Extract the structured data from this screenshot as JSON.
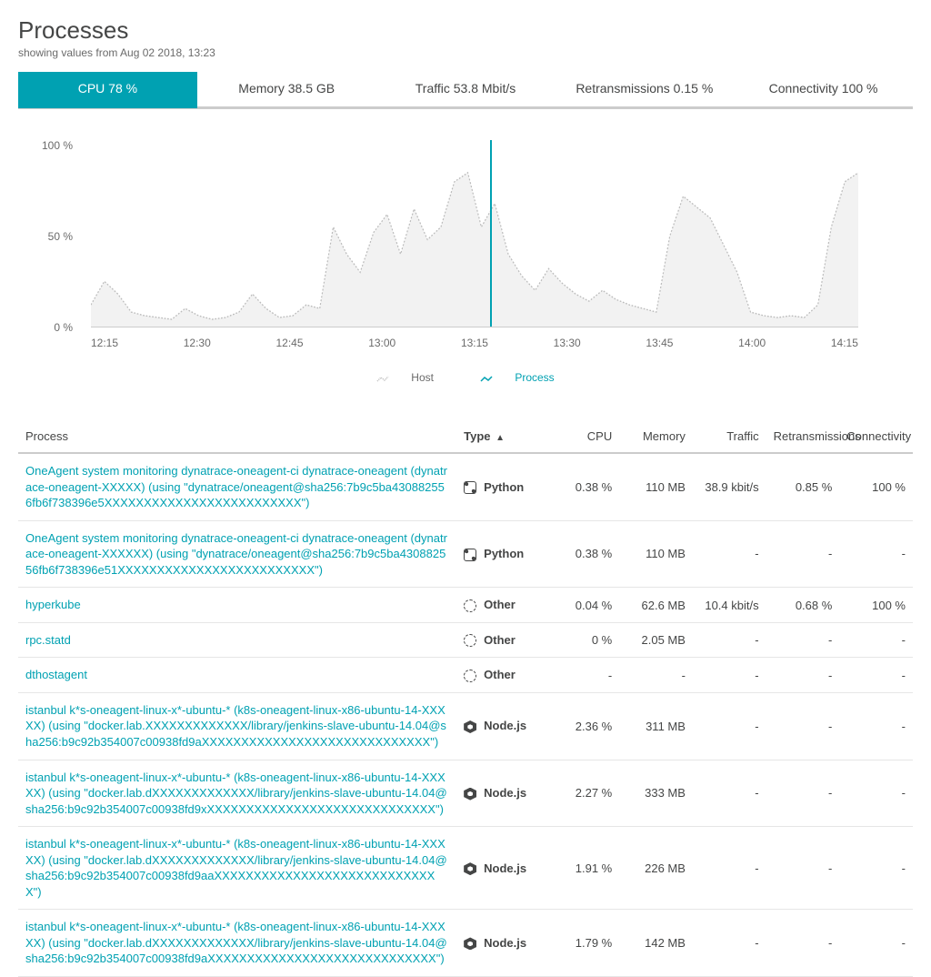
{
  "header": {
    "title": "Processes",
    "subtitle": "showing values from Aug 02 2018, 13:23"
  },
  "tabs": [
    {
      "label": "CPU 78 %",
      "active": true
    },
    {
      "label": "Memory 38.5 GB",
      "active": false
    },
    {
      "label": "Traffic 53.8 Mbit/s",
      "active": false
    },
    {
      "label": "Retransmissions 0.15 %",
      "active": false
    },
    {
      "label": "Connectivity 100 %",
      "active": false
    }
  ],
  "chart_data": {
    "type": "line",
    "title": "",
    "xlabel": "",
    "ylabel": "",
    "ylim": [
      0,
      100
    ],
    "y_ticks": [
      "0 %",
      "50 %",
      "100 %"
    ],
    "x_ticks": [
      "12:15",
      "12:30",
      "12:45",
      "13:00",
      "13:15",
      "13:30",
      "13:45",
      "14:00",
      "14:15"
    ],
    "marker_x": "13:23",
    "marker_pos_pct": 52,
    "series": [
      {
        "name": "Host",
        "color": "#bbbbbb",
        "style": "dotted",
        "values": [
          12,
          25,
          18,
          8,
          6,
          5,
          4,
          10,
          6,
          4,
          5,
          8,
          18,
          10,
          5,
          6,
          12,
          10,
          55,
          40,
          30,
          52,
          62,
          40,
          65,
          48,
          55,
          80,
          85,
          55,
          68,
          40,
          28,
          20,
          32,
          24,
          18,
          14,
          20,
          15,
          12,
          10,
          8,
          50,
          72,
          66,
          60,
          45,
          30,
          8,
          6,
          5,
          6,
          5,
          12,
          55,
          80,
          85
        ]
      }
    ],
    "legend": [
      "Host",
      "Process"
    ]
  },
  "table": {
    "columns": [
      {
        "key": "process",
        "label": "Process",
        "align": "left"
      },
      {
        "key": "type",
        "label": "Type",
        "align": "left",
        "sorted": "asc"
      },
      {
        "key": "cpu",
        "label": "CPU",
        "align": "right"
      },
      {
        "key": "memory",
        "label": "Memory",
        "align": "right"
      },
      {
        "key": "traffic",
        "label": "Traffic",
        "align": "right"
      },
      {
        "key": "retrans",
        "label": "Retransmissions",
        "align": "right"
      },
      {
        "key": "conn",
        "label": "Connectivity",
        "align": "right"
      }
    ],
    "rows": [
      {
        "process": "OneAgent system monitoring dynatrace-oneagent-ci dynatrace-oneagent (dynatrace-oneagent-XXXXX) (using \"dynatrace/oneagent@sha256:7b9c5ba430882556fb6f738396e5XXXXXXXXXXXXXXXXXXXXXXXXX\")",
        "type": "Python",
        "type_icon": "python",
        "cpu": "0.38 %",
        "memory": "110 MB",
        "traffic": "38.9 kbit/s",
        "retrans": "0.85 %",
        "conn": "100 %"
      },
      {
        "process": "OneAgent system monitoring dynatrace-oneagent-ci dynatrace-oneagent (dynatrace-oneagent-XXXXXX) (using \"dynatrace/oneagent@sha256:7b9c5ba430882556fb6f738396e51XXXXXXXXXXXXXXXXXXXXXXXXX\")",
        "type": "Python",
        "type_icon": "python",
        "cpu": "0.38 %",
        "memory": "110 MB",
        "traffic": "-",
        "retrans": "-",
        "conn": "-"
      },
      {
        "process": "hyperkube",
        "type": "Other",
        "type_icon": "other",
        "cpu": "0.04 %",
        "memory": "62.6 MB",
        "traffic": "10.4 kbit/s",
        "retrans": "0.68 %",
        "conn": "100 %"
      },
      {
        "process": "rpc.statd",
        "type": "Other",
        "type_icon": "other",
        "cpu": "0 %",
        "memory": "2.05 MB",
        "traffic": "-",
        "retrans": "-",
        "conn": "-"
      },
      {
        "process": "dthostagent",
        "type": "Other",
        "type_icon": "other",
        "cpu": "-",
        "memory": "-",
        "traffic": "-",
        "retrans": "-",
        "conn": "-"
      },
      {
        "process": "istanbul k*s-oneagent-linux-x*-ubuntu-* (k8s-oneagent-linux-x86-ubuntu-14-XXXXX) (using \"docker.lab.XXXXXXXXXXXXX/library/jenkins-slave-ubuntu-14.04@sha256:b9c92b354007c00938fd9aXXXXXXXXXXXXXXXXXXXXXXXXXXXXX\")",
        "type": "Node.js",
        "type_icon": "nodejs",
        "cpu": "2.36 %",
        "memory": "311 MB",
        "traffic": "-",
        "retrans": "-",
        "conn": "-"
      },
      {
        "process": "istanbul k*s-oneagent-linux-x*-ubuntu-* (k8s-oneagent-linux-x86-ubuntu-14-XXXXX) (using \"docker.lab.dXXXXXXXXXXXXX/library/jenkins-slave-ubuntu-14.04@sha256:b9c92b354007c00938fd9xXXXXXXXXXXXXXXXXXXXXXXXXXXXXX\")",
        "type": "Node.js",
        "type_icon": "nodejs",
        "cpu": "2.27 %",
        "memory": "333 MB",
        "traffic": "-",
        "retrans": "-",
        "conn": "-"
      },
      {
        "process": "istanbul k*s-oneagent-linux-x*-ubuntu-* (k8s-oneagent-linux-x86-ubuntu-14-XXXXX) (using \"docker.lab.dXXXXXXXXXXXXX/library/jenkins-slave-ubuntu-14.04@sha256:b9c92b354007c00938fd9aaXXXXXXXXXXXXXXXXXXXXXXXXXXXXX\")",
        "type": "Node.js",
        "type_icon": "nodejs",
        "cpu": "1.91 %",
        "memory": "226 MB",
        "traffic": "-",
        "retrans": "-",
        "conn": "-"
      },
      {
        "process": "istanbul k*s-oneagent-linux-x*-ubuntu-* (k8s-oneagent-linux-x86-ubuntu-14-XXXXX) (using \"docker.lab.dXXXXXXXXXXXXX/library/jenkins-slave-ubuntu-14.04@sha256:b9c92b354007c00938fd9aXXXXXXXXXXXXXXXXXXXXXXXXXXXXX\")",
        "type": "Node.js",
        "type_icon": "nodejs",
        "cpu": "1.79 %",
        "memory": "142 MB",
        "traffic": "-",
        "retrans": "-",
        "conn": "-"
      }
    ]
  }
}
